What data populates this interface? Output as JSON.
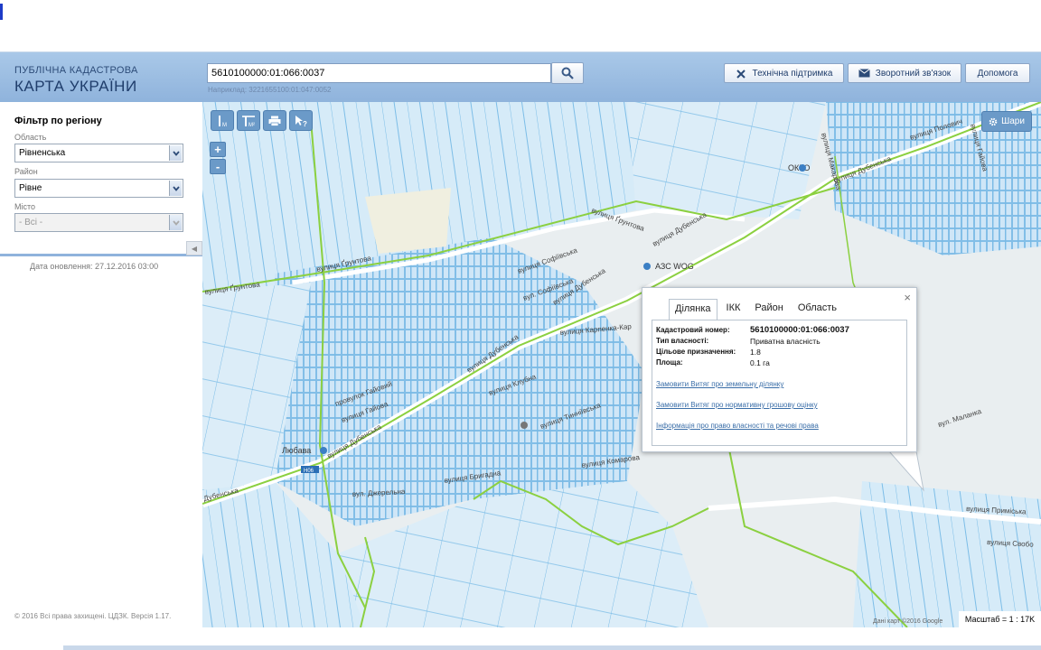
{
  "header": {
    "brand_line1": "ПУБЛІЧНА КАДАСТРОВА",
    "brand_line2": "КАРТА УКРАЇНИ",
    "search_value": "5610100000:01:066:0037",
    "search_hint": "Наприклад: 3221655100:01:047:0052",
    "search_icon": "search-icon",
    "support_label": "Технічна підтримка",
    "feedback_label": "Зворотний зв'язок",
    "help_label": "Допомога"
  },
  "sidebar": {
    "filter_title": "Фільтр по регіону",
    "region_label": "Область",
    "region_value": "Рівненська",
    "district_label": "Район",
    "district_value": "Рівне",
    "city_label": "Місто",
    "city_value": "- Всі -",
    "updated": "Дата оновлення: 27.12.2016 03:00",
    "copyright": "© 2016 Всі права захищені. ЦДЗК. Версія 1.17."
  },
  "map": {
    "layers_label": "Шари",
    "zoom_in": "+",
    "zoom_out": "-",
    "scale": "Масштаб = 1 : 17K",
    "credits": "Дані карт ©2016 Google",
    "labels": {
      "okko": "ОККО",
      "azs": "АЗС WOG",
      "lyubava": "Любава",
      "h06": "H06",
      "st_gruntova1": "вулиця Ґрунтова",
      "st_gruntova2": "вулиця Ґрунтова",
      "st_gruntova3": "вулиця Ґрунтова",
      "st_dubenska1": "вулиця Дубенська",
      "st_dubenska2": "вулиця Дубенська",
      "st_dubenska3": "вулиця Дубенська",
      "st_dubenska4": "вулиця Дубенська",
      "st_dubenska5": "Дубенська",
      "st_sofiivska1": "вулиця Софіївська",
      "st_sofiivska2": "вул. Софіївська",
      "st_karpenka": "вулиця Карпенка-Кар",
      "st_klubna": "вулиця Клубна",
      "st_tynnivska": "вулиця Тинніївська",
      "st_haiova": "вулиця Гайова",
      "st_haiovyi": "провулок Гайовий",
      "st_komarova": "вулиця Комарова",
      "st_brygadna": "вулиця Бригадна",
      "st_dzherelna": "вул. Джерельна",
      "st_prymiska": "вулиця Приміська",
      "st_svobody": "вулиця Свобо",
      "st_makarova": "вулиця Макарова",
      "st_polovych": "вулиця Полович",
      "st_malanka": "вул. Маланка",
      "st_hayovahor": "вулиця Гайова",
      "st_dubenska_top": "вулиця Дубенська"
    }
  },
  "popup": {
    "tabs": [
      "Ділянка",
      "ІКК",
      "Район",
      "Область"
    ],
    "active_tab": "Ділянка",
    "close": "×",
    "rows": [
      {
        "key": "Кадастровий номер:",
        "value": "5610100000:01:066:0037"
      },
      {
        "key": "Тип власності:",
        "value": "Приватна власність"
      },
      {
        "key": "Цільове призначення:",
        "value": "1.8"
      },
      {
        "key": "Площа:",
        "value": "0.1 га"
      }
    ],
    "links": [
      "Замовити Витяг про земельну ділянку",
      "Замовити Витяг про нормативну грошову оцінку",
      "Інформація про право власності та речові права"
    ]
  },
  "colors": {
    "header": "#9fbfe3",
    "parcel": "#7fbde8",
    "boundary": "#8bd040",
    "road": "#ffffff"
  }
}
